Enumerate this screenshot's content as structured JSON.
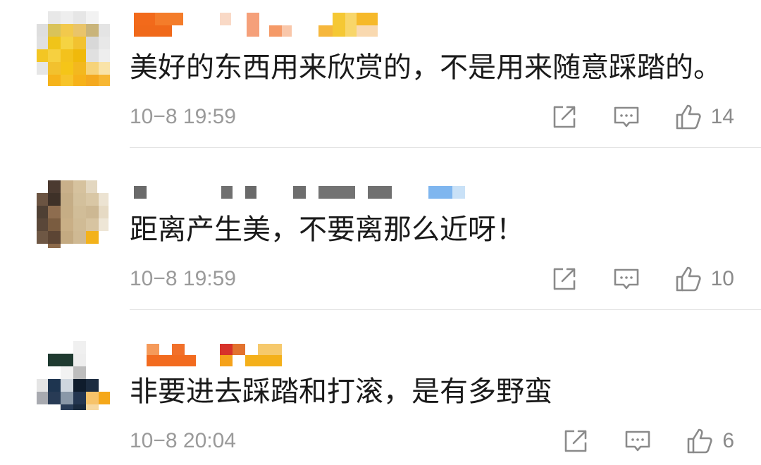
{
  "comments": [
    {
      "text": "美好的东西用来欣赏的，不是用来随意踩踏的。",
      "time": "10−8 19:59",
      "likes": "14",
      "avatar_icon": "pixelated-avatar-yellow",
      "username_icon": "pixelated-username"
    },
    {
      "text": "距离产生美，不要离那么近呀！",
      "time": "10−8 19:59",
      "likes": "10",
      "avatar_icon": "pixelated-avatar-brown",
      "username_icon": "pixelated-username"
    },
    {
      "text": "非要进去踩踏和打滚，是有多野蛮",
      "time": "10−8 20:04",
      "likes": "6",
      "avatar_icon": "pixelated-avatar-dark",
      "username_icon": "pixelated-username"
    }
  ],
  "icons": {
    "share": "share-icon",
    "reply": "reply-icon",
    "like": "thumbs-up-icon"
  },
  "colors": {
    "text": "#1a1a1a",
    "meta": "#9a9a9a",
    "divider": "#e3e3e3",
    "icon": "#8a8a8a"
  }
}
